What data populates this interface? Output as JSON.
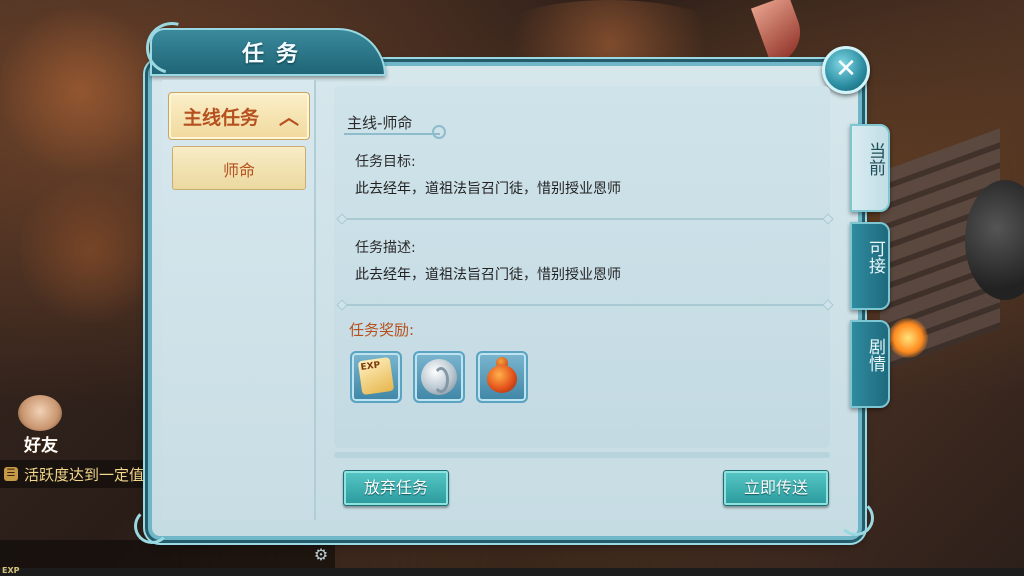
{
  "window": {
    "title": "任务"
  },
  "close_button": {
    "icon": "close-icon",
    "glyph": "✕"
  },
  "categories": [
    {
      "label": "主线任务",
      "expanded": true,
      "arrow": "︿",
      "subitems": [
        {
          "label": "师命",
          "selected": true
        }
      ]
    }
  ],
  "quest": {
    "title": "主线-师命",
    "goal_label": "任务目标:",
    "goal_text": "此去经年，道祖法旨召门徒，惜别授业恩师",
    "desc_label": "任务描述:",
    "desc_text": "此去经年，道祖法旨召门徒，惜别授业恩师",
    "reward_label": "任务奖励:",
    "rewards": [
      {
        "icon": "exp-scroll-icon",
        "text": "EXP"
      },
      {
        "icon": "silver-coin-icon"
      },
      {
        "icon": "gourd-icon"
      }
    ]
  },
  "actions": {
    "abandon": "放弃任务",
    "teleport": "立即传送"
  },
  "side_tabs": [
    {
      "label": "当前",
      "active": true
    },
    {
      "label": "可接",
      "active": false
    },
    {
      "label": "剧情",
      "active": false
    }
  ],
  "hud": {
    "friend_label": "好友",
    "chat_text": "活跃度达到一定值",
    "exp_label": "EXP"
  },
  "colors": {
    "accent": "#2a9a9d",
    "highlight_text": "#b6511f",
    "panel_bg": "#d6e7ec"
  }
}
